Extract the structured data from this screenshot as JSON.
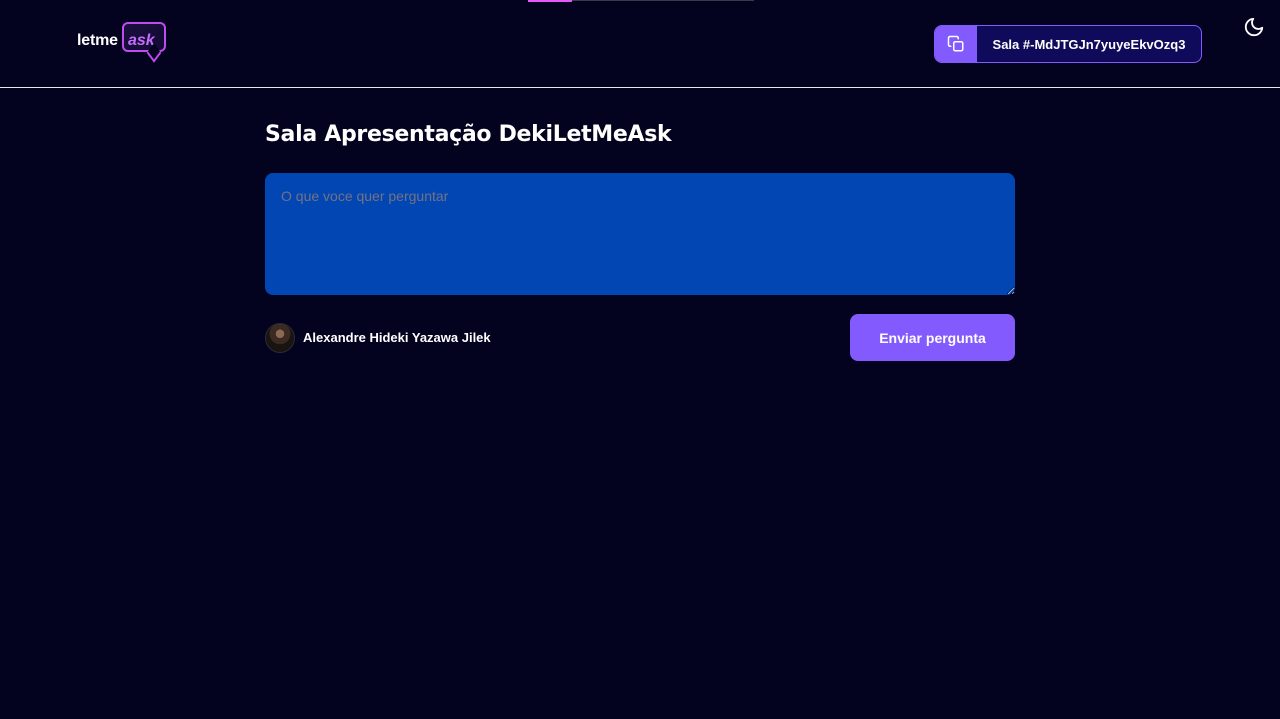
{
  "header": {
    "logo": {
      "text_part1": "letme",
      "text_part2": "ask"
    },
    "room_code": {
      "label": "Sala #-MdJTGJn7yuyeEkvOzq3",
      "icon": "copy-icon"
    },
    "theme_toggle": {
      "icon": "moon-icon"
    }
  },
  "main": {
    "room_title": "Sala Apresentação DekiLetMeAsk",
    "question_input": {
      "placeholder": "O que voce quer perguntar",
      "value": ""
    },
    "user": {
      "name": "Alexandre Hideki Yazawa Jilek",
      "avatar": "user-avatar"
    },
    "send_button_label": "Enviar pergunta"
  },
  "colors": {
    "background": "#03021f",
    "accent": "#835afd",
    "input_bg": "#0246b4",
    "logo_accent": "#c56cff"
  }
}
